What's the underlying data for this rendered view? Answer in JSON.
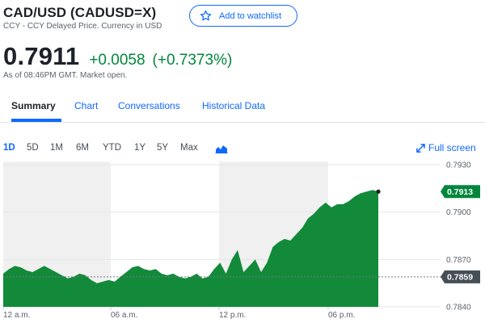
{
  "header": {
    "title": "CAD/USD (CADUSD=X)",
    "subtitle": "CCY - CCY Delayed Price. Currency in USD",
    "watchlist_label": "Add to watchlist"
  },
  "quote": {
    "price": "0.7911",
    "change": "+0.0058",
    "change_pct": "(+0.7373%)",
    "as_of": "As of 08:46PM GMT. Market open."
  },
  "tabs": [
    {
      "label": "Summary",
      "active": true
    },
    {
      "label": "Chart",
      "active": false
    },
    {
      "label": "Conversations",
      "active": false
    },
    {
      "label": "Historical Data",
      "active": false
    }
  ],
  "ranges": [
    {
      "label": "1D",
      "active": true
    },
    {
      "label": "5D",
      "active": false
    },
    {
      "label": "1M",
      "active": false
    },
    {
      "label": "6M",
      "active": false
    },
    {
      "label": "YTD",
      "active": false
    },
    {
      "label": "1Y",
      "active": false
    },
    {
      "label": "5Y",
      "active": false
    },
    {
      "label": "Max",
      "active": false
    }
  ],
  "fullscreen_label": "Full screen",
  "colors": {
    "accent": "#0f69ff",
    "positive": "#00873c",
    "area": "#128a3a",
    "shade": "#f0f0f0",
    "previous_close_badge": "#464e56"
  },
  "chart_data": {
    "type": "area",
    "x_ticks": [
      "12 a.m.",
      "06 a.m.",
      "12 p.m.",
      "06 p.m."
    ],
    "y_ticks": [
      "0.7930",
      "0.7900",
      "0.7870",
      "0.7840"
    ],
    "ylim": [
      0.784,
      0.793
    ],
    "current_label": "0.7913",
    "previous_close_label": "0.7859",
    "current_value": 0.7913,
    "previous_close_value": 0.7859,
    "grid": true,
    "series": [
      {
        "values": [
          0.7861,
          0.7864,
          0.7866,
          0.7865,
          0.7863,
          0.7862,
          0.7864,
          0.7866,
          0.7864,
          0.7862,
          0.786,
          0.7858,
          0.7859,
          0.7861,
          0.786,
          0.7857,
          0.7855,
          0.7856,
          0.7857,
          0.7856,
          0.7859,
          0.7862,
          0.7865,
          0.7866,
          0.7864,
          0.7863,
          0.7864,
          0.7861,
          0.786,
          0.7861,
          0.7859,
          0.7858,
          0.7859,
          0.7861,
          0.7858,
          0.7859,
          0.7864,
          0.7868,
          0.7861,
          0.787,
          0.7876,
          0.7862,
          0.7866,
          0.787,
          0.7862,
          0.7868,
          0.7878,
          0.7881,
          0.7883,
          0.7882,
          0.7886,
          0.789,
          0.7896,
          0.7899,
          0.7903,
          0.7906,
          0.7903,
          0.7905,
          0.7905,
          0.7907,
          0.791,
          0.7912,
          0.7913,
          0.7914,
          0.7913
        ]
      }
    ]
  }
}
